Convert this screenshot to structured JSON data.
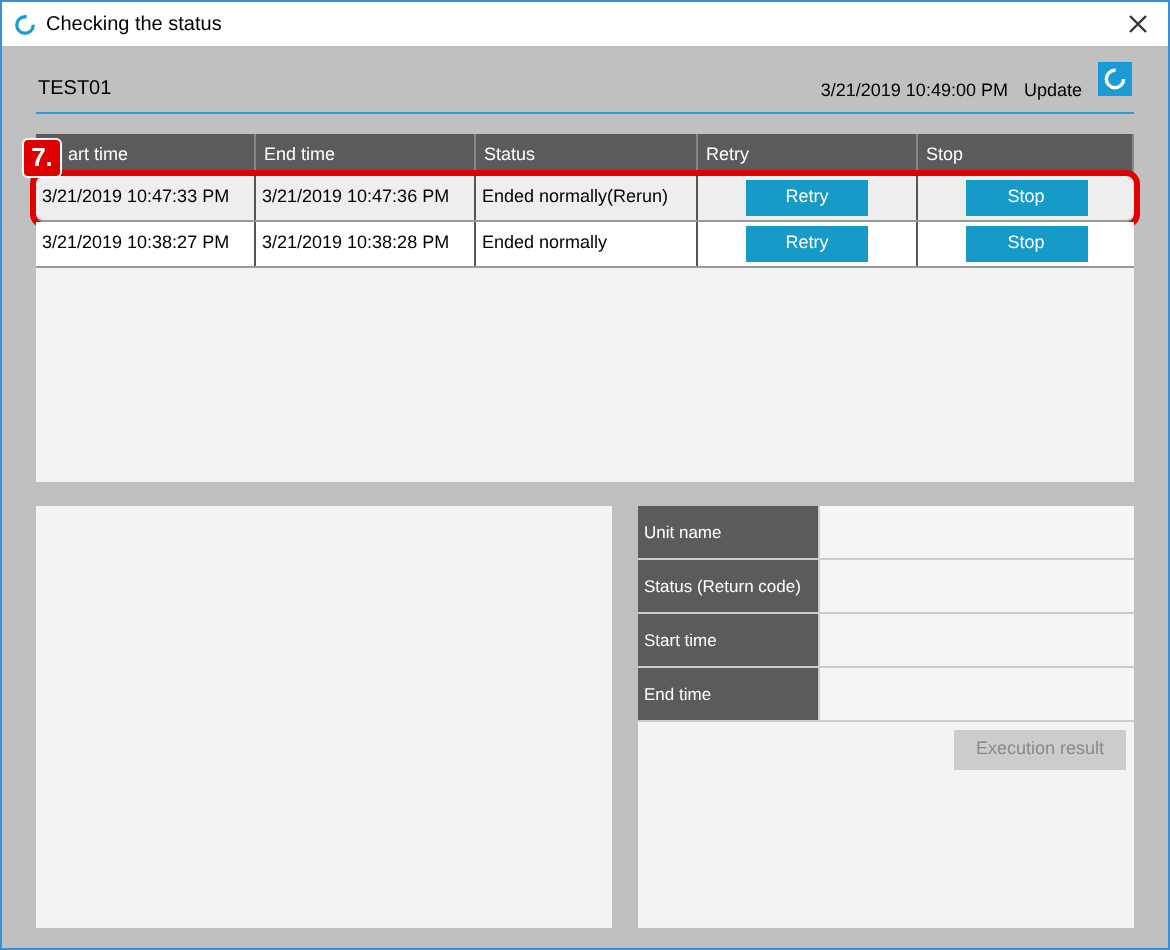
{
  "window": {
    "title": "Checking the status"
  },
  "header": {
    "name": "TEST01",
    "timestamp": "3/21/2019 10:49:00 PM",
    "update_label": "Update"
  },
  "callout": {
    "label": "7."
  },
  "table": {
    "columns": [
      "art time",
      "End time",
      "Status",
      "Retry",
      "Stop"
    ],
    "rows": [
      {
        "start": "3/21/2019 10:47:33 PM",
        "end": "3/21/2019 10:47:36 PM",
        "status": "Ended normally(Rerun)",
        "retry": "Retry",
        "stop": "Stop",
        "highlighted": true
      },
      {
        "start": "3/21/2019 10:38:27 PM",
        "end": "3/21/2019 10:38:28 PM",
        "status": "Ended normally",
        "retry": "Retry",
        "stop": "Stop",
        "highlighted": false
      }
    ]
  },
  "details": {
    "fields": [
      {
        "label": "Unit name"
      },
      {
        "label": "Status (Return code)"
      },
      {
        "label": "Start time"
      },
      {
        "label": "End time"
      }
    ],
    "button": {
      "label": "Execution result",
      "disabled": true
    }
  }
}
